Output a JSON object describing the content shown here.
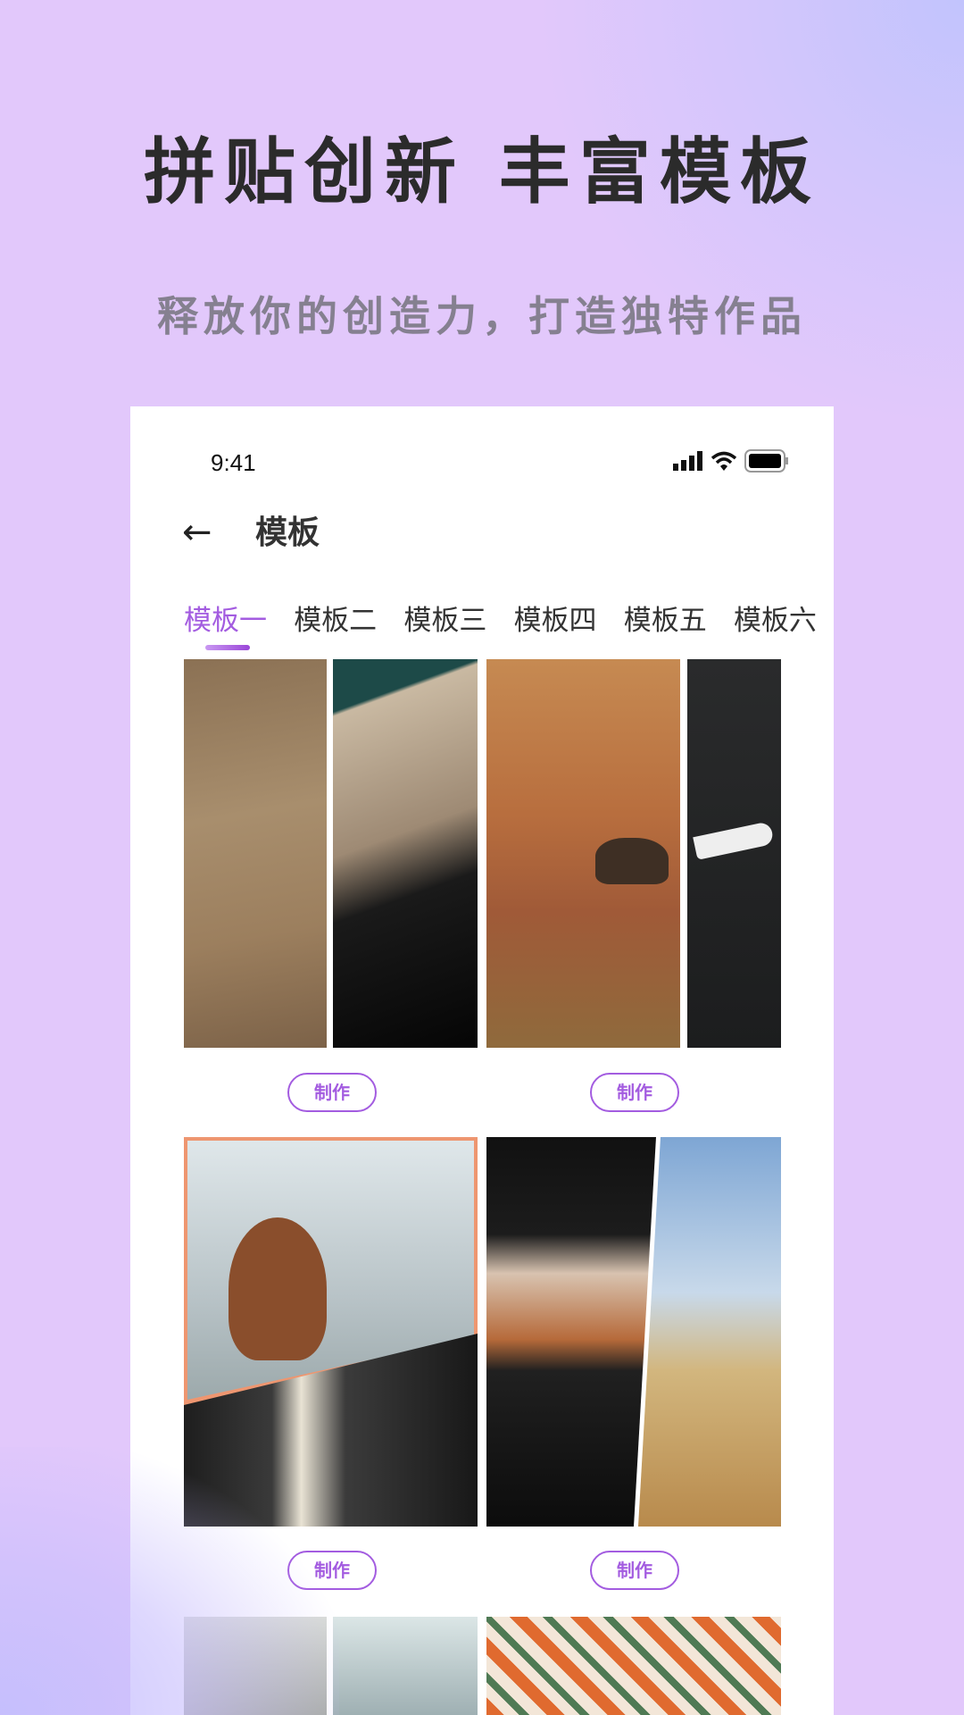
{
  "promo": {
    "headline": "拼贴创新 丰富模板",
    "subheadline": "释放你的创造力，打造独特作品"
  },
  "status_bar": {
    "time": "9:41",
    "icons": [
      "signal-icon",
      "wifi-icon",
      "battery-icon"
    ]
  },
  "header": {
    "back_icon": "arrow-left-icon",
    "title": "模板"
  },
  "tabs": [
    {
      "label": "模板一",
      "active": true
    },
    {
      "label": "模板二"
    },
    {
      "label": "模板三"
    },
    {
      "label": "模板四"
    },
    {
      "label": "模板五"
    },
    {
      "label": "模板六"
    }
  ],
  "templates": [
    {
      "button": "制作"
    },
    {
      "button": "制作"
    },
    {
      "button": "制作"
    },
    {
      "button": "制作"
    }
  ],
  "colors": {
    "accent": "#a35ce0",
    "background": "#e2c8fb"
  }
}
